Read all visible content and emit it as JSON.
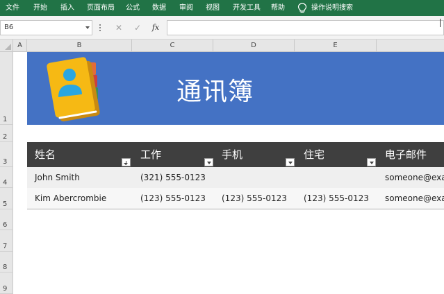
{
  "ribbon": {
    "tabs": [
      "文件",
      "开始",
      "插入",
      "页面布局",
      "公式",
      "数据",
      "审阅",
      "视图",
      "开发工具",
      "帮助"
    ],
    "tell_me": "操作说明搜索"
  },
  "formula_bar": {
    "name_box": "B6",
    "cancel_glyph": "✕",
    "enter_glyph": "✓",
    "fx_label": "fx",
    "value": ""
  },
  "columns": [
    "A",
    "B",
    "C",
    "D",
    "E"
  ],
  "rows": [
    "1",
    "2",
    "3",
    "4",
    "5",
    "6",
    "7",
    "8",
    "9"
  ],
  "banner": {
    "title": "通讯簿",
    "background": "#4472c4",
    "icon": "contact-book-icon"
  },
  "table": {
    "headers": [
      "姓名",
      "工作",
      "手机",
      "住宅",
      "电子邮件"
    ],
    "rows": [
      {
        "name": "John Smith",
        "work": "(321) 555-0123",
        "mobile": "",
        "home": "",
        "email": "someone@exa"
      },
      {
        "name": "Kim Abercrombie",
        "work": "(123) 555-0123",
        "mobile": "(123) 555-0123",
        "home": "(123) 555-0123",
        "email": "someone@exa"
      }
    ],
    "header_background": "#3f3f3f"
  },
  "colors": {
    "ribbon": "#217346",
    "banner": "#4472c4"
  }
}
